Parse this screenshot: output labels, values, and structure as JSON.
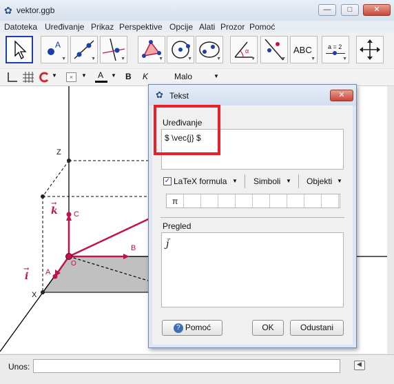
{
  "window": {
    "title": "vektor.ggb",
    "minimize": "—",
    "maximize": "□",
    "close": "✕"
  },
  "menubar": [
    "Datoteka",
    "Uređivanje",
    "Prikaz",
    "Perspektive",
    "Opcije",
    "Alati",
    "Prozor",
    "Pomoć"
  ],
  "toolbar": {
    "tools": [
      "move-tool",
      "point-tool",
      "line-tool",
      "perpendicular-tool",
      "polygon-tool",
      "circle-tool",
      "conic-tool",
      "angle-tool",
      "reflect-tool",
      "text-tool",
      "slider-tool",
      "move-graphics-tool"
    ],
    "text_tool_label": "ABC",
    "slider_tool_label": "a = 2"
  },
  "stylebar": {
    "bold": "B",
    "italic": "K",
    "text_color": "A",
    "size_value": "Malo"
  },
  "graphics": {
    "labels": {
      "z": "Z",
      "x": "X",
      "c": "C",
      "b": "B",
      "o": "O",
      "a": "A",
      "k": "k",
      "i": "i"
    },
    "colors": {
      "vector": "#c0134a",
      "polygon": "#c0c0c0",
      "axis": "#000000"
    }
  },
  "dialog": {
    "title": "Tekst",
    "edit_label": "Uređivanje",
    "edit_value": "$ \\vec{j} $",
    "latex_checked": true,
    "latex_label": "LaTeX formula",
    "symbols_label": "Simboli",
    "objects_label": "Objekti",
    "symbol_first": "π",
    "preview_label": "Pregled",
    "preview_value": "j",
    "help_button": "Pomoć",
    "ok_button": "OK",
    "cancel_button": "Odustani"
  },
  "inputbar": {
    "label": "Unos:",
    "value": ""
  },
  "highlight_color": "#e8202a"
}
